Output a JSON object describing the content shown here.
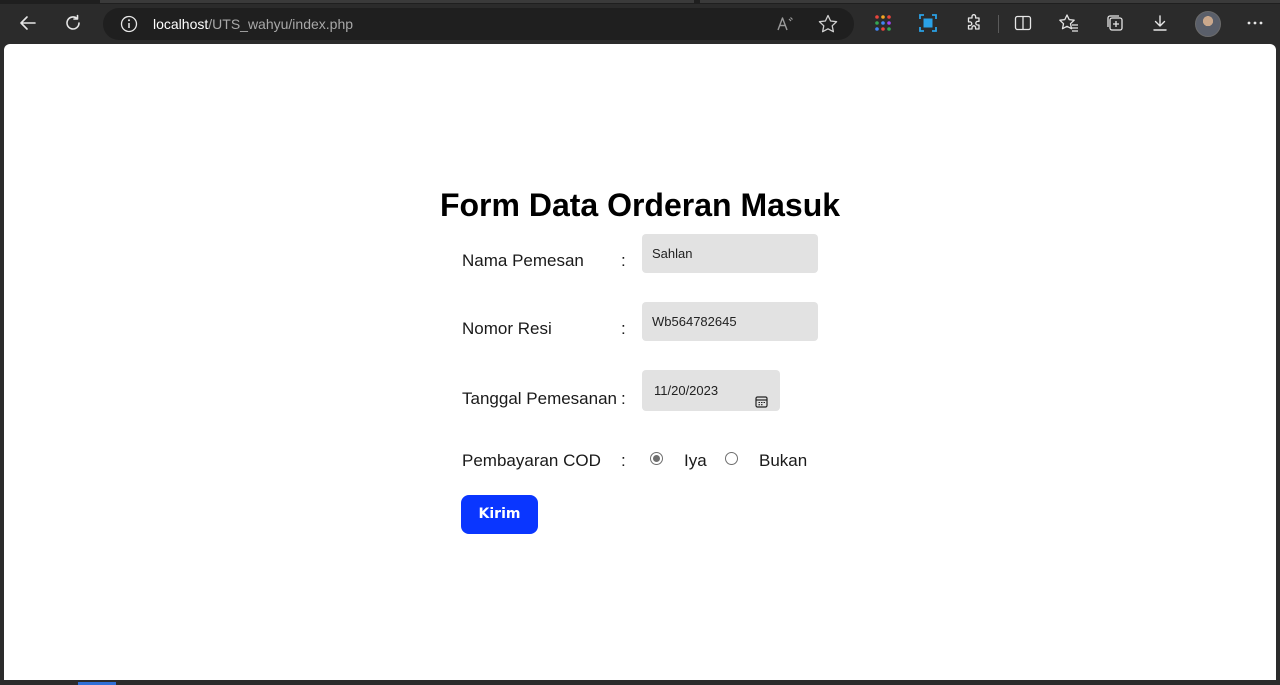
{
  "browser": {
    "url_host": "localhost",
    "url_path": "/UTS_wahyu/index.php",
    "icons": [
      "back-icon",
      "refresh-icon",
      "info-icon",
      "read-aloud-icon",
      "favorite-star-icon",
      "apps-icon",
      "screenshot-icon",
      "extensions-icon",
      "split-screen-icon",
      "favorites-icon",
      "collections-icon",
      "download-icon",
      "avatar",
      "more-icon"
    ]
  },
  "form": {
    "title": "Form Data Orderan Masuk",
    "colon": ":",
    "nama_label": "Nama Pemesan",
    "nama_value": "Sahlan",
    "resi_label": "Nomor Resi",
    "resi_value": "Wb564782645",
    "tanggal_label": "Tanggal Pemesanan",
    "tanggal_value": "11/20/2023",
    "cod_label": "Pembayaran COD",
    "cod_options": [
      "Iya",
      "Bukan"
    ],
    "cod_selected": "Iya",
    "submit_label": "Kirim"
  },
  "colors": {
    "button": "#0a36ff",
    "field_bg": "#e2e2e2",
    "chrome_bg": "#2b2b2b"
  }
}
